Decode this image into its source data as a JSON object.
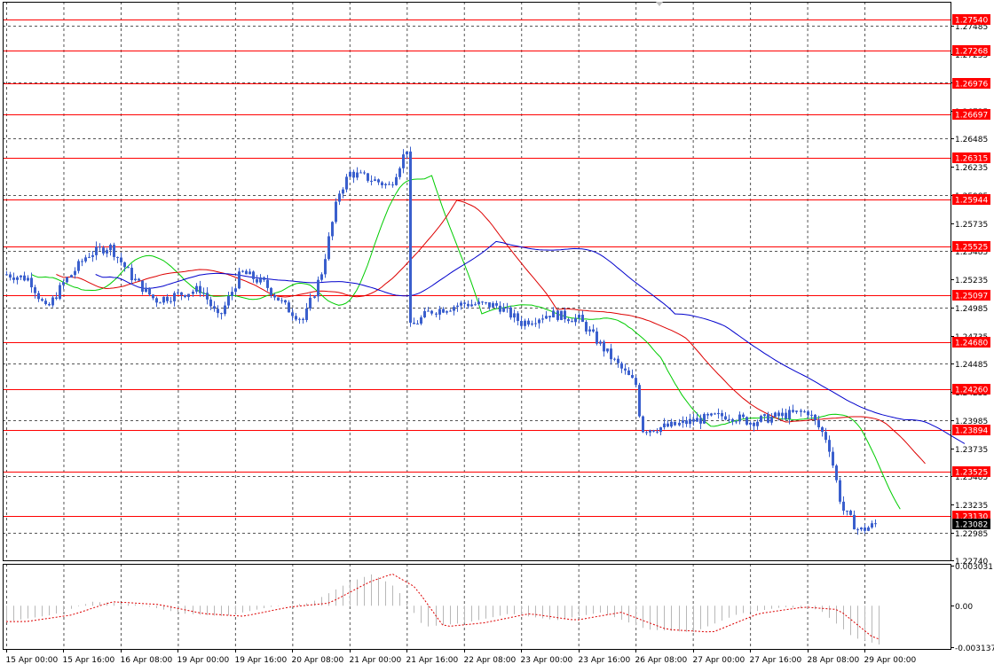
{
  "chart_data": [
    {
      "type": "candlestick",
      "title": "",
      "xlabel": "",
      "ylabel": "",
      "ylim": [
        1.2274,
        1.277
      ],
      "grid": true,
      "x_ticks": [
        "15 Apr 00:00",
        "15 Apr 16:00",
        "16 Apr 08:00",
        "19 Apr 00:00",
        "19 Apr 16:00",
        "20 Apr 08:00",
        "21 Apr 00:00",
        "21 Apr 16:00",
        "22 Apr 08:00",
        "23 Apr 00:00",
        "23 Apr 16:00",
        "26 Apr 08:00",
        "27 Apr 00:00",
        "27 Apr 16:00",
        "28 Apr 08:00",
        "29 Apr 00:00"
      ],
      "y_ticks": [
        "1.27485",
        "1.27235",
        "1.26985",
        "1.26735",
        "1.26485",
        "1.26235",
        "1.25985",
        "1.25735",
        "1.25485",
        "1.25235",
        "1.24985",
        "1.24735",
        "1.24485",
        "1.24235",
        "1.23985",
        "1.23735",
        "1.23485",
        "1.23235",
        "1.22985",
        "1.22740"
      ],
      "levels": [
        {
          "label": "1.27540",
          "value": 1.2754
        },
        {
          "label": "1.27268",
          "value": 1.27268
        },
        {
          "label": "1.26976",
          "value": 1.26976
        },
        {
          "label": "1.26697",
          "value": 1.26697
        },
        {
          "label": "1.26315",
          "value": 1.26315
        },
        {
          "label": "1.25944",
          "value": 1.25944
        },
        {
          "label": "1.25525",
          "value": 1.25525
        },
        {
          "label": "1.25097",
          "value": 1.25097
        },
        {
          "label": "1.24680",
          "value": 1.2468
        },
        {
          "label": "1.24260",
          "value": 1.2426
        },
        {
          "label": "1.23894",
          "value": 1.23894
        },
        {
          "label": "1.23525",
          "value": 1.23525
        },
        {
          "label": "1.23130",
          "value": 1.2313
        }
      ],
      "current_price": "1.23082",
      "path_points": [
        {
          "tick": 0,
          "price": 1.2528
        },
        {
          "tick": 0.4,
          "price": 1.2524
        },
        {
          "tick": 0.7,
          "price": 1.2496
        },
        {
          "tick": 1.0,
          "price": 1.252
        },
        {
          "tick": 1.4,
          "price": 1.2545
        },
        {
          "tick": 1.8,
          "price": 1.2553
        },
        {
          "tick": 2.2,
          "price": 1.2525
        },
        {
          "tick": 2.6,
          "price": 1.2505
        },
        {
          "tick": 3.0,
          "price": 1.251
        },
        {
          "tick": 3.4,
          "price": 1.2515
        },
        {
          "tick": 3.7,
          "price": 1.2488
        },
        {
          "tick": 4.1,
          "price": 1.253
        },
        {
          "tick": 4.5,
          "price": 1.252
        },
        {
          "tick": 4.9,
          "price": 1.2498
        },
        {
          "tick": 5.2,
          "price": 1.2487
        },
        {
          "tick": 5.5,
          "price": 1.253
        },
        {
          "tick": 5.8,
          "price": 1.26
        },
        {
          "tick": 6.0,
          "price": 1.2618
        },
        {
          "tick": 6.4,
          "price": 1.2612
        },
        {
          "tick": 6.7,
          "price": 1.2606
        },
        {
          "tick": 7.0,
          "price": 1.264
        },
        {
          "tick": 7.05,
          "price": 1.248
        },
        {
          "tick": 7.4,
          "price": 1.2495
        },
        {
          "tick": 8.0,
          "price": 1.2502
        },
        {
          "tick": 8.6,
          "price": 1.25
        },
        {
          "tick": 9.0,
          "price": 1.2485
        },
        {
          "tick": 9.5,
          "price": 1.2493
        },
        {
          "tick": 10.0,
          "price": 1.2488
        },
        {
          "tick": 10.6,
          "price": 1.2452
        },
        {
          "tick": 11.0,
          "price": 1.243
        },
        {
          "tick": 11.1,
          "price": 1.239
        },
        {
          "tick": 11.6,
          "price": 1.2393
        },
        {
          "tick": 12.0,
          "price": 1.2398
        },
        {
          "tick": 12.6,
          "price": 1.2403
        },
        {
          "tick": 13.0,
          "price": 1.2397
        },
        {
          "tick": 13.6,
          "price": 1.2403
        },
        {
          "tick": 14.0,
          "price": 1.2406
        },
        {
          "tick": 14.35,
          "price": 1.238
        },
        {
          "tick": 14.6,
          "price": 1.232
        },
        {
          "tick": 14.9,
          "price": 1.23
        },
        {
          "tick": 15.2,
          "price": 1.2306
        }
      ]
    },
    {
      "type": "histogram",
      "title": "",
      "ylim": [
        -0.003137,
        0.003031
      ],
      "y_ticks": [
        "0.003031",
        "0.00",
        "-0.003137"
      ],
      "path_points": [
        {
          "tick": 0,
          "value": -0.0012
        },
        {
          "tick": 0.8,
          "value": -0.0007
        },
        {
          "tick": 1.5,
          "value": 0.0003
        },
        {
          "tick": 2.3,
          "value": 0.0001
        },
        {
          "tick": 3.1,
          "value": -0.0006
        },
        {
          "tick": 3.8,
          "value": -0.0008
        },
        {
          "tick": 4.6,
          "value": -0.0001
        },
        {
          "tick": 5.3,
          "value": 0.0002
        },
        {
          "tick": 6.0,
          "value": 0.0018
        },
        {
          "tick": 6.4,
          "value": 0.0024
        },
        {
          "tick": 6.8,
          "value": 0.0014
        },
        {
          "tick": 7.3,
          "value": -0.0016
        },
        {
          "tick": 8.0,
          "value": -0.0013
        },
        {
          "tick": 8.8,
          "value": -0.0006
        },
        {
          "tick": 9.6,
          "value": -0.0011
        },
        {
          "tick": 10.4,
          "value": -0.0005
        },
        {
          "tick": 11.2,
          "value": -0.0018
        },
        {
          "tick": 12.0,
          "value": -0.002
        },
        {
          "tick": 12.8,
          "value": -0.0006
        },
        {
          "tick": 13.6,
          "value": -0.0001
        },
        {
          "tick": 14.2,
          "value": -0.0003
        },
        {
          "tick": 14.8,
          "value": -0.0024
        },
        {
          "tick": 15.3,
          "value": -0.003
        }
      ]
    }
  ],
  "colors": {
    "candle": "#3a5fcd",
    "ma_fast": "#00cc00",
    "ma_mid": "#dd0000",
    "ma_slow": "#0000cc",
    "level_line": "#ff0000",
    "level_label_bg": "#ff0000",
    "current_label_bg": "#000000",
    "grid": "#555555",
    "osc_bar": "#b8b8b8",
    "osc_signal": "#dd0000"
  }
}
